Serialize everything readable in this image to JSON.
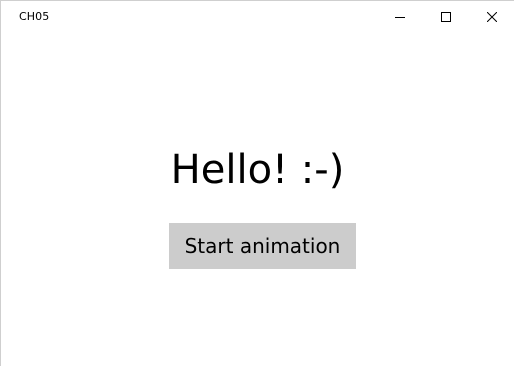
{
  "window": {
    "title": "CH05"
  },
  "main": {
    "greeting": "Hello! :-)",
    "start_button_label": "Start animation"
  },
  "icons": {
    "minimize": "minimize-icon",
    "maximize": "maximize-icon",
    "close": "close-icon"
  },
  "colors": {
    "button_background": "#cccccc",
    "window_background": "#ffffff",
    "text": "#000000"
  }
}
